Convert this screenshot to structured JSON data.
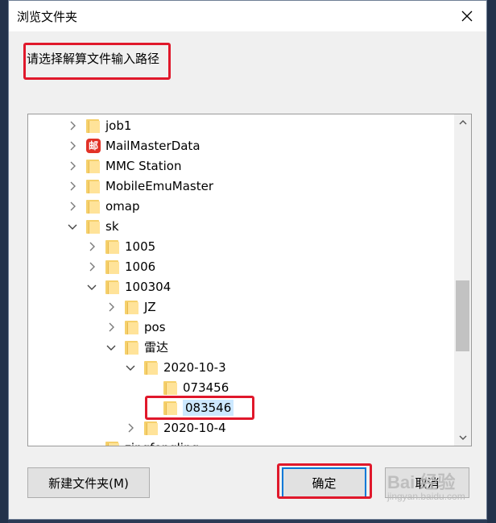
{
  "window": {
    "title": "浏览文件夹",
    "close_icon": "close-icon"
  },
  "prompt": "请选择解算文件输入路径",
  "tree": {
    "items": [
      {
        "label": "job1",
        "level": 0,
        "state": "collapsed",
        "icon": "folder-icon"
      },
      {
        "label": "MailMasterData",
        "level": 0,
        "state": "collapsed",
        "icon": "mailmaster-icon",
        "icon_text": "邮"
      },
      {
        "label": "MMC Station",
        "level": 0,
        "state": "collapsed",
        "icon": "folder-icon"
      },
      {
        "label": "MobileEmuMaster",
        "level": 0,
        "state": "collapsed",
        "icon": "folder-icon"
      },
      {
        "label": "omap",
        "level": 0,
        "state": "collapsed",
        "icon": "folder-icon"
      },
      {
        "label": "sk",
        "level": 0,
        "state": "expanded",
        "icon": "folder-icon"
      },
      {
        "label": "1005",
        "level": 1,
        "state": "collapsed",
        "icon": "folder-icon"
      },
      {
        "label": "1006",
        "level": 1,
        "state": "collapsed",
        "icon": "folder-icon"
      },
      {
        "label": "100304",
        "level": 1,
        "state": "expanded",
        "icon": "folder-icon"
      },
      {
        "label": "JZ",
        "level": 2,
        "state": "collapsed",
        "icon": "folder-icon"
      },
      {
        "label": "pos",
        "level": 2,
        "state": "collapsed",
        "icon": "folder-icon"
      },
      {
        "label": "雷达",
        "level": 2,
        "state": "expanded",
        "icon": "folder-icon"
      },
      {
        "label": "2020-10-3",
        "level": 3,
        "state": "expanded",
        "icon": "folder-icon"
      },
      {
        "label": "073456",
        "level": 4,
        "state": "none",
        "icon": "folder-icon"
      },
      {
        "label": "083546",
        "level": 4,
        "state": "none",
        "icon": "folder-icon",
        "selected": true
      },
      {
        "label": "2020-10-4",
        "level": 3,
        "state": "collapsed",
        "icon": "folder-icon"
      },
      {
        "label": "zingfengling",
        "level": 1,
        "state": "none",
        "icon": "folder-icon"
      }
    ]
  },
  "buttons": {
    "new_folder": "新建文件夹(M)",
    "ok": "确定",
    "cancel": "取消"
  },
  "watermark": {
    "text": "Bai 经验",
    "url": "jingyan.baidu.com"
  },
  "colors": {
    "highlight": "#e0182b",
    "selection": "#cce8ff",
    "folder": "#f5d06b"
  }
}
